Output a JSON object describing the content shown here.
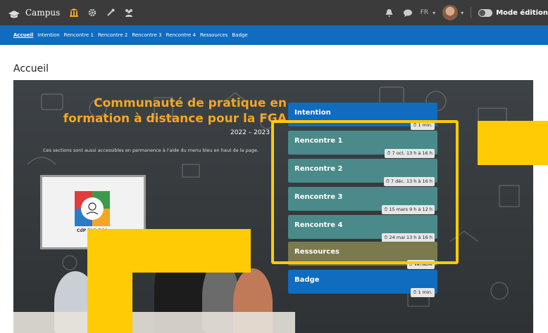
{
  "topbar": {
    "brand": "Campus",
    "lang": "FR",
    "lang_caret": "▾",
    "user_caret": "▾",
    "mode_label": "Mode édition",
    "icons": [
      "graduation-cap-icon",
      "bank-icon",
      "gear-icon",
      "wrench-icon",
      "users-icon",
      "bell-icon",
      "chat-icon"
    ]
  },
  "nav": {
    "items": [
      "Accueil",
      "Intention",
      "Rencontre 1",
      "Rencontre 2",
      "Rencontre 3",
      "Rencontre 4",
      "Ressources",
      "Badge"
    ]
  },
  "page": {
    "title": "Accueil"
  },
  "hero": {
    "title_line1": "Communauté de pratique en",
    "title_line2": "formation à distance pour la FGA",
    "year": "2022 – 2023",
    "caption": "Ces sections sont aussi accessibles en permanence à l'aide du menu bleu en haut de la page.",
    "board_logo_text": "CdP FAD FGA"
  },
  "cards": [
    {
      "label": "Intention",
      "badge": "⏱ 1 min."
    },
    {
      "label": "Rencontre 1",
      "badge": "⏱ 7 oct. 13 h à 16 h"
    },
    {
      "label": "Rencontre 2",
      "badge": "⏱ 7 déc. 13 h à 16 h"
    },
    {
      "label": "Rencontre 3",
      "badge": "⏱ 15 mars 9 h à 12 h"
    },
    {
      "label": "Rencontre 4",
      "badge": "⏱ 24 mai 13 h à 16 h"
    },
    {
      "label": "Ressources",
      "badge": "⏱ Variable"
    },
    {
      "label": "Badge",
      "badge": "⏱ 1 min."
    }
  ],
  "colors": {
    "topbar": "#3b3b3b",
    "nav": "#0f6cbf",
    "accent_yellow": "#ffcb05",
    "title_orange": "#f5a623",
    "card_blue": "#0f6cbf",
    "card_teal": "#4a8a8a"
  }
}
